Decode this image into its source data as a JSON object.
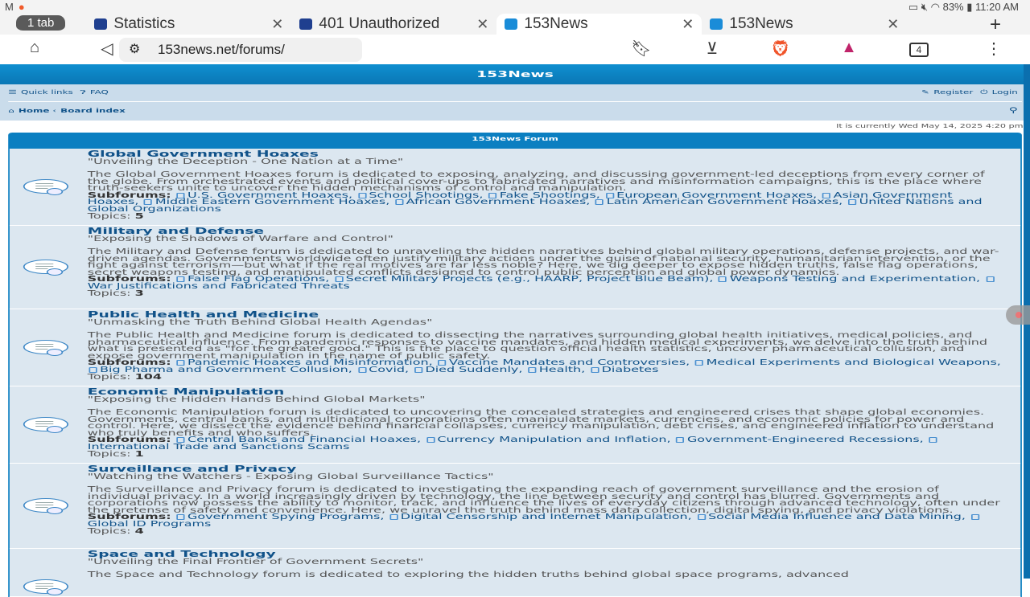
{
  "status": {
    "battery": "83%",
    "time": "11:20 AM"
  },
  "browser": {
    "tab_count": "1 tab",
    "tabs": [
      {
        "title": "Statistics",
        "color": "#1f3f8f"
      },
      {
        "title": "401 Unauthorized",
        "color": "#1f3f8f"
      },
      {
        "title": "153News",
        "color": "#1a8cd8"
      },
      {
        "title": "153News",
        "color": "#1a8cd8"
      }
    ],
    "url": "153news.net/forums/",
    "tabs_button": "4"
  },
  "site": {
    "title": "153News",
    "quick_links": "Quick links",
    "faq": "FAQ",
    "register": "Register",
    "login": "Login",
    "home": "Home",
    "board_index": "Board index",
    "date": "It is currently Wed May 14, 2025 4:20 pm",
    "category": "153News Forum",
    "subforums_label": "Subforums:",
    "topics_label": "Topics:"
  },
  "forums": [
    {
      "title": "Global Government Hoaxes",
      "tagline": "\"Unveiling the Deception - One Nation at a Time\"",
      "description": "The Global Government Hoaxes forum is dedicated to exposing, analyzing, and discussing government-led deceptions from every corner of the globe. From orchestrated events and political cover-ups to fabricated narratives and misinformation campaigns, this is the place where truth-seekers unite to uncover the hidden mechanisms of control and manipulation.",
      "subforums": [
        "U.S. Government Hoaxes",
        "School Shootings",
        "Fake Shootings",
        "European Government Hoaxes",
        "Asian Government Hoaxes",
        "Middle Eastern Government Hoaxes",
        "African Government Hoaxes",
        "Latin American Government Hoaxes",
        "United Nations and Global Organizations"
      ],
      "topics": "5"
    },
    {
      "title": "Military and Defense",
      "tagline": "\"Exposing the Shadows of Warfare and Control\"",
      "description": "The Military and Defense forum is dedicated to unraveling the hidden narratives behind global military operations, defense projects, and war-driven agendas. Governments worldwide often justify military actions under the guise of national security, humanitarian intervention, or the fight against terrorism—but what if the real motives are far less noble? Here, we dig deeper to expose hidden truths, false flag operations, secret weapons testing, and manipulated conflicts designed to control public perception and global power dynamics.",
      "subforums": [
        "False Flag Operations",
        "Secret Military Projects (e.g., HAARP, Project Blue Beam)",
        "Weapons Testing and Experimentation",
        "War Justifications and Fabricated Threats"
      ],
      "topics": "3"
    },
    {
      "title": "Public Health and Medicine",
      "tagline": "\"Unmasking the Truth Behind Global Health Agendas\"",
      "description": "The Public Health and Medicine forum is dedicated to dissecting the narratives surrounding global health initiatives, medical policies, and pharmaceutical influence. From pandemic responses to vaccine mandates, and hidden medical experiments, we delve into the truth behind what is presented as \"for the greater good.\" This is the place to question official health statistics, uncover pharmaceutical collusion, and expose government manipulation in the name of public safety.",
      "subforums": [
        "Pandemic Hoaxes and Misinformation",
        "Vaccine Mandates and Controversies",
        "Medical Experiments and Biological Weapons",
        "Big Pharma and Government Collusion",
        "Covid",
        "Died Suddenly",
        "Health",
        "Diabetes"
      ],
      "topics": "104"
    },
    {
      "title": "Economic Manipulation",
      "tagline": "\"Exposing the Hidden Hands Behind Global Markets\"",
      "description": "The Economic Manipulation forum is dedicated to uncovering the concealed strategies and engineered crises that shape global economies. Governments, central banks, and multinational corporations often manipulate markets, currencies, and economic policies for power and control. Here, we dissect the evidence behind financial collapses, currency manipulation, debt crises, and engineered inflation to understand who truly benefits and who suffers.",
      "subforums": [
        "Central Banks and Financial Hoaxes",
        "Currency Manipulation and Inflation",
        "Government-Engineered Recessions",
        "International Trade and Sanctions Scams"
      ],
      "topics": "1"
    },
    {
      "title": "Surveillance and Privacy",
      "tagline": "\"Watching the Watchers - Exposing Global Surveillance Tactics\"",
      "description": "The Surveillance and Privacy forum is dedicated to investigating the expanding reach of government surveillance and the erosion of individual privacy. In a world increasingly driven by technology, the line between security and control has blurred. Governments and corporations now possess the ability to monitor, track, and influence the lives of everyday citizens through advanced technology, often under the pretense of safety and convenience. Here, we unravel the truth behind mass data collection, digital spying, and privacy violations.",
      "subforums": [
        "Government Spying Programs",
        "Digital Censorship and Internet Manipulation",
        "Social Media Influence and Data Mining",
        "Global ID Programs"
      ],
      "topics": "4"
    },
    {
      "title": "Space and Technology",
      "tagline": "\"Unveiling the Final Frontier of Government Secrets\"",
      "description": "The Space and Technology forum is dedicated to exploring the hidden truths behind global space programs, advanced",
      "subforums": [],
      "topics": ""
    }
  ]
}
